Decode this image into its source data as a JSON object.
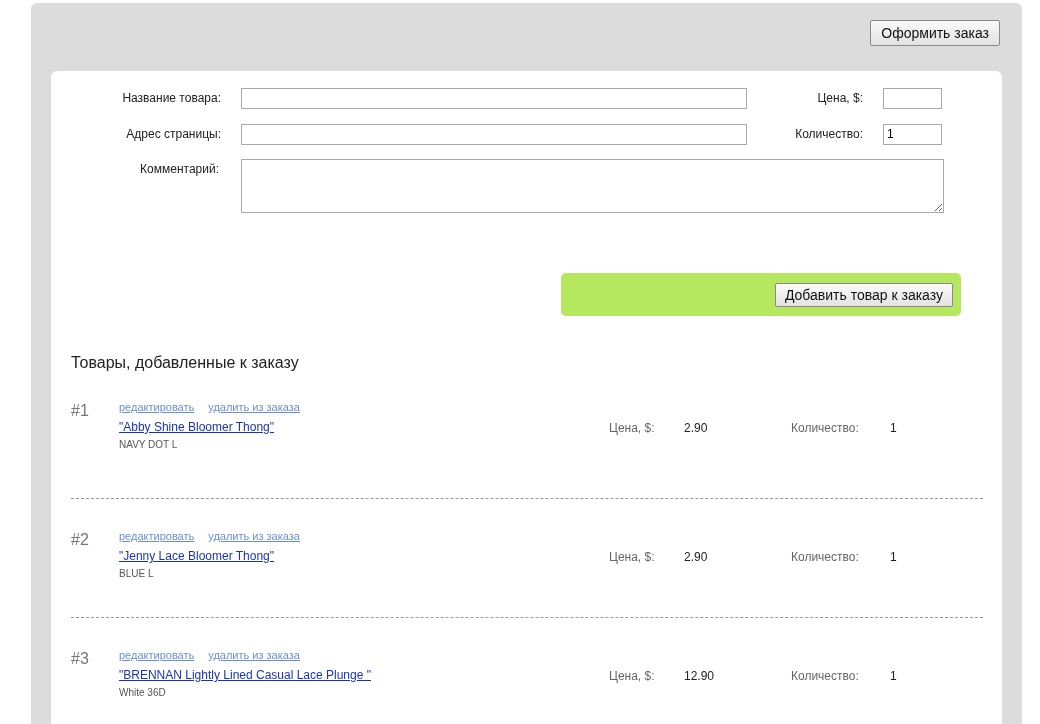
{
  "checkout_button": "Оформить заказ",
  "form": {
    "name_label": "Название товара:",
    "url_label": "Адрес страницы:",
    "price_label": "Цена, $:",
    "quantity_label": "Количество:",
    "quantity_value": "1",
    "comment_label": "Комментарий:"
  },
  "add_button": "Добавить товар к заказу",
  "section_title": "Товары, добавленные к заказу",
  "items": [
    {
      "number": "#1",
      "edit_link": "редактировать",
      "remove_link": "удалить из заказа",
      "title": "\"Abby Shine Bloomer Thong\"",
      "variant": "NAVY DOT L",
      "price_label": "Цена, $:",
      "price": "2.90",
      "quantity_label": "Количество:",
      "quantity": "1"
    },
    {
      "number": "#2",
      "edit_link": "редактировать",
      "remove_link": "удалить из заказа",
      "title": "\"Jenny Lace Bloomer Thong\"",
      "variant": "BLUE L",
      "price_label": "Цена, $:",
      "price": "2.90",
      "quantity_label": "Количество:",
      "quantity": "1"
    },
    {
      "number": "#3",
      "edit_link": "редактировать",
      "remove_link": "удалить из заказа",
      "title": "\"BRENNAN Lightly Lined Casual Lace Plunge \"",
      "variant": "White 36D",
      "price_label": "Цена, $:",
      "price": "12.90",
      "quantity_label": "Количество:",
      "quantity": "1"
    }
  ]
}
